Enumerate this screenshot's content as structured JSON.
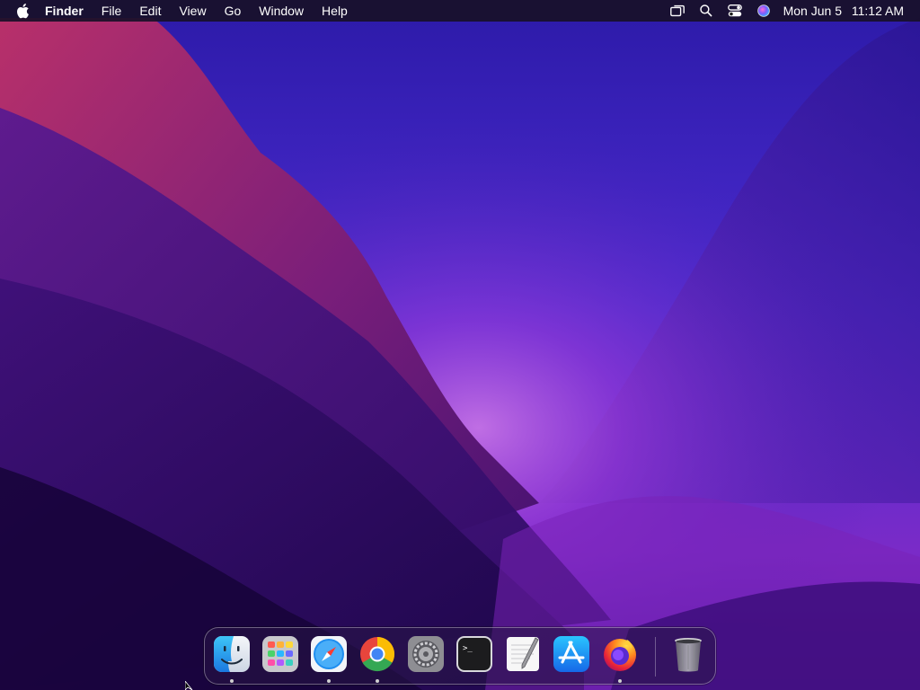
{
  "menubar": {
    "apple_icon": "apple-logo-icon",
    "app_name": "Finder",
    "menus": [
      "File",
      "Edit",
      "View",
      "Go",
      "Window",
      "Help"
    ],
    "status_icons": [
      "screen-mirroring-icon",
      "spotlight-search-icon",
      "control-center-icon",
      "siri-icon"
    ],
    "clock": {
      "date": "Mon Jun 5",
      "time": "11:12 AM"
    }
  },
  "dock": {
    "items": [
      {
        "name": "finder",
        "icon": "finder-icon",
        "running": true
      },
      {
        "name": "launchpad",
        "icon": "launchpad-icon",
        "running": false
      },
      {
        "name": "safari",
        "icon": "safari-icon",
        "running": true
      },
      {
        "name": "chrome",
        "icon": "chrome-icon",
        "running": true
      },
      {
        "name": "system-preferences",
        "icon": "system-preferences-icon",
        "running": false
      },
      {
        "name": "terminal",
        "icon": "terminal-icon",
        "running": false
      },
      {
        "name": "textedit",
        "icon": "textedit-icon",
        "running": false
      },
      {
        "name": "app-store",
        "icon": "app-store-icon",
        "running": false
      },
      {
        "name": "firefox",
        "icon": "firefox-icon",
        "running": true
      },
      {
        "name": "trash",
        "icon": "trash-icon",
        "running": false
      }
    ]
  },
  "terminal_prompt": ">_",
  "colors": {
    "menubar_bg": "#181028",
    "wallpaper_top": "#3a1fc0",
    "wallpaper_glow": "#a03ad0",
    "wallpaper_red": "#a8245e",
    "wallpaper_dark": "#1a0840"
  }
}
